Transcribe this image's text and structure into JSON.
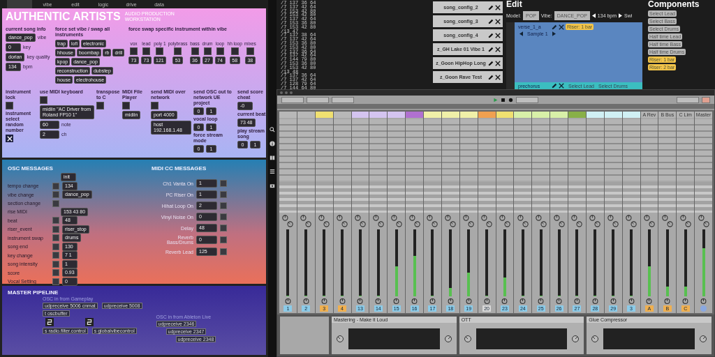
{
  "left_tabs": [
    {
      "selected": true
    },
    {
      "label": "vibe",
      "selected": false
    },
    {
      "label": "edit",
      "selected": false
    },
    {
      "label": "logic",
      "selected": false
    },
    {
      "label": "drive",
      "selected": false
    },
    {
      "label": "data",
      "selected": false
    }
  ],
  "header": {
    "title": "AUTHENTIC ARTISTS",
    "subtitle": "AUDIO PRODUCTION WORKSTATION"
  },
  "song_info": {
    "title": "current song info",
    "fields": [
      {
        "value": "dance_pop",
        "label": "vibe"
      },
      {
        "value": "0",
        "label": "key"
      },
      {
        "value": "dorian",
        "label": "key quality"
      },
      {
        "value": "134",
        "label": "bpm"
      }
    ]
  },
  "vibes": {
    "title": "force set vibe / swap all instruments",
    "buttons": [
      "trap",
      "lofi",
      "electronic",
      "hhouse",
      "boombap",
      "rb",
      "drill",
      "kpop",
      "dance_pop",
      "reconstruction",
      "dubstep",
      "house",
      "electrohouse"
    ]
  },
  "swap": {
    "title": "force swap specific instrument within vibe",
    "columns": [
      {
        "label": "vox",
        "value": "73"
      },
      {
        "label": "lead",
        "value": "73"
      },
      {
        "label": "poly 1",
        "value": "121"
      },
      {
        "label": "polybrass",
        "value": "53"
      },
      {
        "label": "bass",
        "value": "36"
      },
      {
        "label": "drum",
        "value": "27"
      },
      {
        "label": "loop",
        "value": "74"
      },
      {
        "label": "hh loop",
        "value": "58"
      },
      {
        "label": "mixes",
        "value": "38"
      }
    ]
  },
  "controls": [
    [
      {
        "kind": "label",
        "text": "instrument lock"
      },
      {
        "kind": "toggle"
      },
      {
        "kind": "label",
        "text": "instrument select random number"
      },
      {
        "kind": "x"
      }
    ],
    [
      {
        "kind": "label",
        "text": "use MIDI keyboard"
      },
      {
        "kind": "toggle"
      },
      {
        "kind": "field",
        "text": "midiin \"AC Driver from Roland FP10 1\""
      },
      {
        "kind": "unit",
        "text": "60",
        "unit": "note"
      },
      {
        "kind": "unit",
        "text": "2",
        "unit": "ch"
      }
    ],
    [
      {
        "kind": "label",
        "text": "transpose to C"
      },
      {
        "kind": "toggle"
      }
    ],
    [
      {
        "kind": "label",
        "text": "MIDI File Player"
      },
      {
        "kind": "toggle"
      },
      {
        "kind": "field",
        "text": "midiin"
      }
    ],
    [
      {
        "kind": "label",
        "text": "send MIDI over network"
      },
      {
        "kind": "toggle"
      },
      {
        "kind": "field",
        "text": "port 4000"
      },
      {
        "kind": "field",
        "text": "host 192.168.1.48"
      }
    ],
    [
      {
        "kind": "label",
        "text": "send OSC out to network UE project"
      },
      {
        "kind": "pair",
        "values": [
          "0",
          "1"
        ]
      },
      {
        "kind": "label",
        "text": "vocal loop"
      },
      {
        "kind": "pair",
        "values": [
          "0",
          "1"
        ]
      },
      {
        "kind": "label",
        "text": "force stream mode"
      },
      {
        "kind": "pair",
        "values": [
          "0",
          "1"
        ]
      }
    ],
    [
      {
        "kind": "label",
        "text": "send score cheat"
      },
      {
        "kind": "field",
        "text": "-0"
      },
      {
        "kind": "label",
        "text": "current beat"
      },
      {
        "kind": "field",
        "text": "73 48"
      },
      {
        "kind": "label",
        "text": "play stream song"
      },
      {
        "kind": "pair",
        "values": [
          "0",
          "1"
        ]
      }
    ]
  ],
  "osc": {
    "title": "OSC MESSAGES",
    "init": "init",
    "rows": [
      {
        "kind": "both",
        "label": "tempo change",
        "value": "134"
      },
      {
        "kind": "both",
        "label": "vibe change",
        "value": "dance_pop"
      },
      {
        "kind": "toggle",
        "label": "section change"
      },
      {
        "kind": "value",
        "label": "rise MIDI",
        "value": "153 43 80"
      },
      {
        "kind": "both",
        "label": "beat",
        "value": "48"
      },
      {
        "kind": "both",
        "label": "riser_event",
        "value": "riser_stop"
      },
      {
        "kind": "both",
        "label": "instrument swap",
        "value": "drums"
      },
      {
        "kind": "both",
        "label": "song end",
        "value": "130"
      },
      {
        "kind": "both",
        "label": "key change",
        "value": "7 1"
      },
      {
        "kind": "both",
        "label": "song intensity",
        "value": "1"
      },
      {
        "kind": "both",
        "label": "score",
        "value": "0.93"
      },
      {
        "kind": "both",
        "label": "Vocal Setting",
        "value": "0"
      }
    ]
  },
  "midi_cc": {
    "title": "MIDI CC MESSAGES",
    "rows": [
      {
        "label": "Ch1 Vanta On",
        "value": "1"
      },
      {
        "label": "PC Riser On",
        "value": "1"
      },
      {
        "label": "Hihat Loop On",
        "value": "2"
      },
      {
        "label": "Vinyl Noise On",
        "value": "0"
      },
      {
        "label": "Delay",
        "value": "48"
      },
      {
        "label": "Reverb Bass/Drums",
        "value": "0"
      },
      {
        "label": "Reverb Lead",
        "value": "125"
      }
    ]
  },
  "pipeline": {
    "title": "MASTER PIPELINE",
    "groups": [
      {
        "caption": "OSC in from Gameplay",
        "objects": [
          "udpreceive 5006 cnmat",
          "udpreceive 5008"
        ]
      },
      {
        "caption": "OSC in from Ableton Live",
        "objects": [
          "udpreceive 2346",
          "udpreceive 2347",
          "udpreceive 2348"
        ]
      }
    ],
    "small": [
      "t oscbuffer"
    ],
    "bottom": [
      "s radio.filter.control",
      "s globalvibecontrol"
    ]
  },
  "console": {
    "lines": [
      "/7 137 36 64",
      "/7 137 42 64",
      "/7 153 42 80",
      "/7 153 42 80",
      "/7 137 42 64",
      "/7 153 36 80",
      "/7 153 42 80",
      "/13 47",
      "/7 137 38 64",
      "/7 137 42 64",
      "/7 153 36 80",
      "/7 153 42 80",
      "/7 137 36 64",
      "/7 137 42 64",
      "/7 144 79 80",
      "/7 153 36 80",
      "/7 153 42 80",
      "/13 48",
      "/7 137 36 64",
      "/7 137 42 64",
      "/7 128 79 64",
      "/7 144 64 80"
    ]
  },
  "song_configs": [
    "song_config_2",
    "song_config_3",
    "song_config_4",
    "z_GH Lake 01 Vibe 1",
    "z_Goon HipHop Long",
    "z_Goon Rave Test"
  ],
  "edit": {
    "title": "Edit",
    "model_label": "Model:",
    "model": "POP",
    "vibe_label": "Vibe:",
    "vibe": "DANCE_POP",
    "bpm": "134 bpm",
    "switch": "Swi",
    "section": {
      "name": "verse_1_a",
      "tag": "Riser: 1 bar",
      "sample": "Sample 1"
    },
    "next": {
      "name": "prechorus",
      "tags": [
        "Select Lead",
        "Select Drums"
      ]
    }
  },
  "components": {
    "title": "Components",
    "chips": [
      {
        "label": "Select Lead",
        "kind": "plain"
      },
      {
        "label": "Select Bass",
        "kind": "plain"
      },
      {
        "label": "Select Drums",
        "kind": "plain"
      },
      {
        "label": "Half time Lead",
        "kind": "plain"
      },
      {
        "label": "Half time Bass",
        "kind": "plain"
      },
      {
        "label": "Half time Drums",
        "kind": "plain"
      },
      {
        "label": "Riser: 1 bar",
        "kind": "riser"
      },
      {
        "label": "Riser: 2 bar",
        "kind": "riser"
      }
    ]
  },
  "mixer": {
    "tracks": [
      {
        "number": "1",
        "kind": "track",
        "color": "#b8b8b8",
        "level": 0
      },
      {
        "number": "2",
        "kind": "track",
        "color": "#b8b8b8",
        "level": 0
      },
      {
        "number": "3",
        "kind": "group",
        "color": "#f0e070",
        "level": 0
      },
      {
        "number": "4",
        "kind": "group",
        "color": "#b8b8b8",
        "level": 0
      },
      {
        "number": "13",
        "kind": "track",
        "color": "#d4c4f0",
        "level": 0
      },
      {
        "number": "14",
        "kind": "track",
        "color": "#d4c4f0",
        "level": 0
      },
      {
        "number": "15",
        "kind": "track",
        "color": "#d4c4f0",
        "level": 0.45
      },
      {
        "number": "16",
        "kind": "track",
        "color": "#b070d0",
        "level": 0.6
      },
      {
        "number": "17",
        "kind": "track",
        "color": "#f0f0a8",
        "level": 0
      },
      {
        "number": "18",
        "kind": "track",
        "color": "#f0f0a8",
        "level": 0.12
      },
      {
        "number": "19",
        "kind": "track",
        "color": "#f0f0a8",
        "level": 0.35
      },
      {
        "number": "20",
        "kind": "plain",
        "color": "#f0a050",
        "level": 0
      },
      {
        "number": "23",
        "kind": "track",
        "color": "#f0e070",
        "level": 0.28
      },
      {
        "number": "24",
        "kind": "track",
        "color": "#d8f0a8",
        "level": 0
      },
      {
        "number": "25",
        "kind": "track",
        "color": "#d8f0a8",
        "level": 0
      },
      {
        "number": "26",
        "kind": "track",
        "color": "#d8f0a8",
        "level": 0
      },
      {
        "number": "27",
        "kind": "track",
        "color": "#88b048",
        "level": 0
      },
      {
        "number": "28",
        "kind": "track",
        "color": "#d0f0f4",
        "level": 0
      },
      {
        "number": "29",
        "kind": "track",
        "color": "#d0f0f4",
        "level": 0
      },
      {
        "number": "3",
        "kind": "track",
        "color": "#d0f0f4",
        "level": 0
      },
      {
        "number": "A",
        "kind": "return",
        "name": "A Rev",
        "color": "#b4b4b4",
        "level": 0.45
      },
      {
        "number": "B",
        "kind": "return",
        "name": "B Bus",
        "color": "#b4b4b4",
        "level": 0.15
      },
      {
        "number": "C",
        "kind": "return",
        "name": "C Lim",
        "color": "#b4b4b4",
        "level": 0.15
      },
      {
        "kind": "master",
        "name": "Master",
        "color": "#b4b4b4",
        "level": 0.72
      }
    ]
  },
  "devices": [
    "Mastering - Make it Loud",
    "OTT",
    "Glue Compressor"
  ]
}
